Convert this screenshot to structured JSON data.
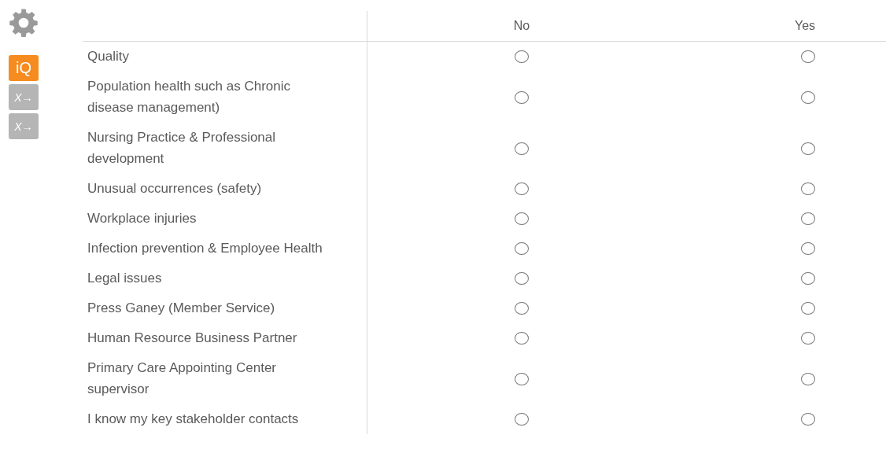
{
  "sidebar": {
    "iq_badge": "iQ",
    "tools": [
      "X→",
      "X→"
    ]
  },
  "table": {
    "columns": [
      "No",
      "Yes"
    ],
    "rows": [
      {
        "label": "Quality",
        "options": [
          {
            "selected": false
          },
          {
            "selected": false
          }
        ]
      },
      {
        "label": "Population health such as Chronic disease management)",
        "options": [
          {
            "selected": false
          },
          {
            "selected": false
          }
        ]
      },
      {
        "label": "Nursing Practice & Professional development",
        "options": [
          {
            "selected": false
          },
          {
            "selected": false
          }
        ]
      },
      {
        "label": "Unusual occurrences (safety)",
        "options": [
          {
            "selected": false
          },
          {
            "selected": false
          }
        ]
      },
      {
        "label": "Workplace injuries",
        "options": [
          {
            "selected": false
          },
          {
            "selected": false
          }
        ]
      },
      {
        "label": "Infection prevention & Employee Health",
        "options": [
          {
            "selected": false
          },
          {
            "selected": false
          }
        ]
      },
      {
        "label": "Legal issues",
        "options": [
          {
            "selected": false
          },
          {
            "selected": false
          }
        ]
      },
      {
        "label": "Press Ganey (Member Service)",
        "options": [
          {
            "selected": false
          },
          {
            "selected": false
          }
        ]
      },
      {
        "label": "Human Resource Business Partner",
        "options": [
          {
            "selected": false
          },
          {
            "selected": false
          }
        ]
      },
      {
        "label": "Primary Care Appointing Center supervisor",
        "options": [
          {
            "selected": false
          },
          {
            "selected": false
          }
        ]
      },
      {
        "label": "I know my key stakeholder contacts",
        "options": [
          {
            "selected": false
          },
          {
            "selected": false
          }
        ]
      }
    ]
  }
}
